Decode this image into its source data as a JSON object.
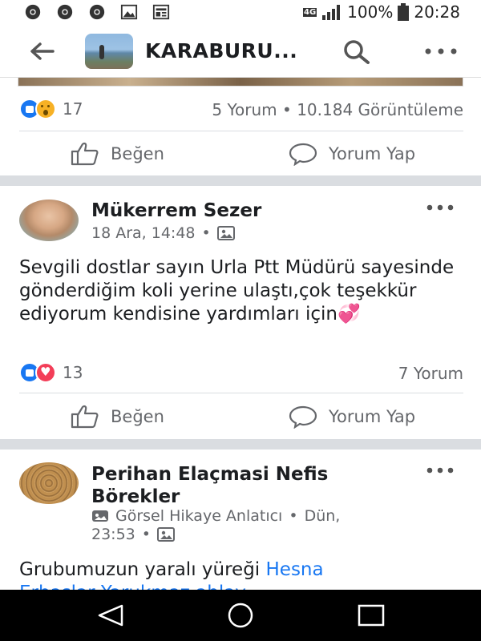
{
  "status_bar": {
    "network": "4G",
    "battery": "100%",
    "time": "20:28",
    "left_icons": [
      "chrome-icon",
      "chrome-icon",
      "chrome-icon",
      "image-icon",
      "news-icon"
    ]
  },
  "app_bar": {
    "title": "KARABURU..."
  },
  "top_card": {
    "reaction_count": "17",
    "comments": "5 Yorum",
    "separator": "•",
    "views": "10.184 Görüntüleme",
    "like_label": "Beğen",
    "comment_label": "Yorum Yap"
  },
  "post1": {
    "author": "Mükerrem Sezer",
    "time": "18 Ara, 14:48",
    "separator": "•",
    "text": "Sevgili dostlar sayın Urla Ptt Müdürü sayesinde gönderdiğim koli yerine ulaştı,çok  teşekkür ediyorum kendisine yardımları için",
    "emoji": "💞",
    "reaction_count": "13",
    "comments": "7 Yorum",
    "like_label": "Beğen",
    "comment_label": "Yorum Yap"
  },
  "post2": {
    "author_line1": "Perihan Elaçmasi Nefis",
    "author_line2": "Börekler",
    "badge": "Görsel Hikaye Anlatıcı",
    "separator": "•",
    "time_part1": "Dün,",
    "time_part2": "23:53",
    "text_prefix": "Grubumuzun yaralı yüreği ",
    "text_link": "Hesna",
    "text_line2_partial": "Erbaşlar Yarukmaz ablay"
  },
  "colors": {
    "accent": "#1877f2",
    "love": "#f33e58",
    "wow": "#f7b125",
    "text": "#1c1e21",
    "secondary": "#65676b"
  }
}
